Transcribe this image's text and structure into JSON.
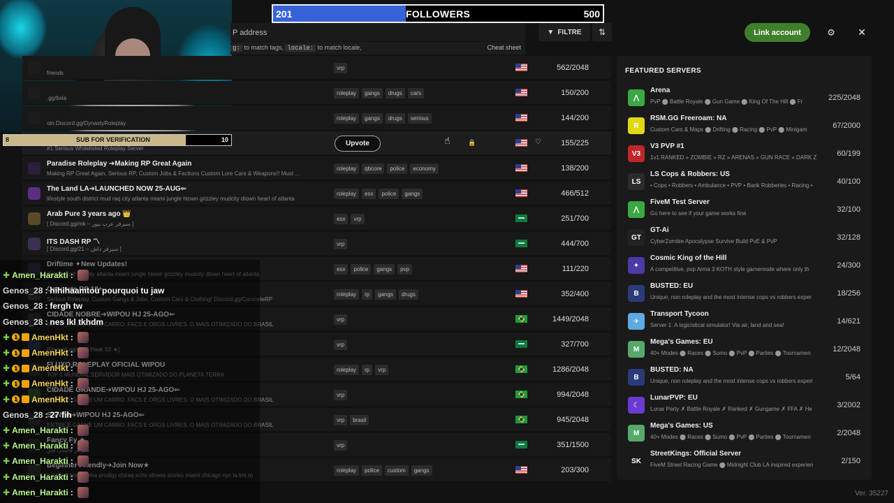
{
  "header": {
    "search_placeholder": "P address",
    "hint_code1": "g:",
    "hint_text1": " to match tags, ",
    "hint_code2": "locale:",
    "hint_text2": " to match locale,",
    "cheat_sheet": "Cheat sheet",
    "filter_label": "FILTRE",
    "link_account": "Link account"
  },
  "followers_goal": {
    "current": "201",
    "label": "FOLLOWERS",
    "goal": "500",
    "fraction": 0.402
  },
  "sub_goal": {
    "current": "8",
    "label": "SUB FOR VERIFICATION",
    "goal": "10",
    "fraction": 0.8
  },
  "servers": [
    {
      "name": "",
      "desc": "friends",
      "tags": [
        "vrp"
      ],
      "flag": "us",
      "players": "562/2048",
      "icon_color": "#1c1c1c"
    },
    {
      "name": "",
      "desc": ".gg/bsla",
      "tags": [
        "roleplay",
        "gangs",
        "drugs",
        "cars"
      ],
      "flag": "us",
      "players": "150/200",
      "icon_color": "#1c1c1c"
    },
    {
      "name": "",
      "desc": "oin Discord.gg/DynastyRoleplay",
      "tags": [
        "roleplay",
        "gangs",
        "drugs",
        "serious"
      ],
      "flag": "us",
      "players": "144/200",
      "icon_color": "#1c1c1c"
    },
    {
      "name": "",
      "desc": "#1 Serious Whitelisted Roleplay Server",
      "tags": [],
      "flag": "us",
      "players": "155/225",
      "icon_color": "#1c1c1c",
      "upvote": "Upvote",
      "highlight": true
    },
    {
      "name": "Paradise Roleplay ➔Making RP Great Again",
      "desc": "Making RP Great Again, Serious RP, Custom Jobs & Factions Custom Lore Cars & Weapons!! Must ...",
      "tags": [
        "roleplay",
        "qbcore",
        "police",
        "economy"
      ],
      "flag": "us",
      "players": "138/200",
      "icon_color": "#2a1f3c"
    },
    {
      "name": "The Land LA➔LAUNCHED NOW 25-AUG⇐",
      "desc": "lifestyle south district mud raq city atlanta miami jungle htown grizzley mudcity dtown heart of atlanta",
      "tags": [
        "roleplay",
        "esx",
        "police",
        "gangs"
      ],
      "flag": "us",
      "players": "466/512",
      "icon_color": "#5a2f83"
    },
    {
      "name": "Arab Pure 3 years ago 👑",
      "desc": "[ Discord.gg/mk – سيرفر عرب بيور ]",
      "tags": [
        "esx",
        "vrp"
      ],
      "flag": "sa",
      "players": "251/700",
      "icon_color": "#5a4a2a"
    },
    {
      "name": "ITS DASH RP 〽",
      "desc": "[ Discord.gg/21 – سيرفر داش ]",
      "tags": [
        "vrp"
      ],
      "flag": "sa",
      "players": "444/700",
      "icon_color": "#3c3052"
    },
    {
      "name": "Driftime ✦New Updates!",
      "desc": "district mud raq city atlanta miami jungle htown grizzley mudcity dtown heart of atlanta",
      "tags": [
        "esx",
        "police",
        "gangs",
        "pvp"
      ],
      "flag": "us",
      "players": "111/220",
      "icon_color": "#2a2a3c"
    },
    {
      "name": "Concrete RP 18+",
      "desc": "Serious Roleplay, Custom Gangs & Jobs, Custom Cars & Clothing! Discord.gg/ConcreteRP",
      "tags": [
        "roleplay",
        "rp",
        "gangs",
        "drugs"
      ],
      "flag": "us",
      "players": "352/400",
      "icon_color": "#333"
    },
    {
      "name": "CIDADE NOBRE➔WIPOU HJ 25-AGO⇐",
      "desc": "ENTRE E GANHE UM CARRO. FACS E ORGS LIVRES. O MAIS OTIMIZADO DO BRASIL",
      "tags": [
        "vrp"
      ],
      "flag": "br",
      "players": "1449/2048",
      "icon_color": "#2d2d2d"
    },
    {
      "name": "",
      "desc": "[Discord.gg/s2 ➔ Peak S2 ★]",
      "tags": [
        "vrp"
      ],
      "flag": "sa",
      "players": "327/700",
      "icon_color": "#24314a"
    },
    {
      "name": "FLUXO ROLEPLAY OFICIAL WIPOU",
      "desc": "TOP 1 MUNDIAL SERVIDOR MAIS OTIMIZADO DO PLANETA TERRA",
      "tags": [
        "roleplay",
        "rp",
        "vrp"
      ],
      "flag": "br",
      "players": "1286/2048",
      "icon_color": "#2d2d2d"
    },
    {
      "name": "CIDADE GRANDE➔WIPOU HJ 25-AGO⇐",
      "desc": "ENTRE E GANHE UM CARRO. FACS E ORGS LIVRES. O MAIS OTIMIZADO DO BRASIL",
      "tags": [
        "vrp"
      ],
      "flag": "br",
      "players": "994/2048",
      "icon_color": "#2a4a2a"
    },
    {
      "name": "SANTA➔WIPOU HJ 25-AGO⇐",
      "desc": "ENTRE E GANHE UM CARRO. FACS E ORGS LIVRES. O MAIS OTIMIZADO DO BRASIL",
      "tags": [
        "vrp",
        "brasil"
      ],
      "flag": "br",
      "players": "945/2048",
      "icon_color": "#2d2d2d"
    },
    {
      "name": "Fancy Fy ★",
      "desc": "سيرفر فانسي فاي",
      "tags": [
        "vrp"
      ],
      "flag": "sa",
      "players": "351/1500",
      "icon_color": "#2d2d2d"
    },
    {
      "name": "Beginner Friendly➔Join Now★",
      "desc": "h d town hoods pma prodigy chiraq echo streets stories miami chicago nyc la lmt rp",
      "tags": [
        "roleplay",
        "police",
        "custom",
        "gangs"
      ],
      "flag": "us",
      "players": "203/300",
      "icon_color": "#2d2d2d"
    }
  ],
  "featured": {
    "title": "FEATURED SERVERS",
    "items": [
      {
        "name": "Arena",
        "desc": "PvP ⬤ Battle Royale ⬤ Gun Game ⬤ King Of The Hill ⬤ Fr",
        "players": "225/2048",
        "icon_color": "#3aa843",
        "icon_glyph": "⋀"
      },
      {
        "name": "RSM.GG Freeroam: NA",
        "desc": "Custom Cars & Maps ⬤ Drifting ⬤ Racing ⬤ PvP ⬤ Minigam",
        "players": "67/2000",
        "icon_color": "#e1d814",
        "icon_glyph": "R"
      },
      {
        "name": "V3 PVP #1",
        "desc": "1v1 RANKED » ZOMBIE » RZ » ARENAS » GUN RACE » DARK Z",
        "players": "60/199",
        "icon_color": "#c0262a",
        "icon_glyph": "V3"
      },
      {
        "name": "LS Cops & Robbers: US",
        "desc": "• Cops • Robbers • Ambulance • PVP • Bank Robberies • Racing •",
        "players": "40/100",
        "icon_color": "#2b2b2b",
        "icon_glyph": "LS"
      },
      {
        "name": "FiveM Test Server",
        "desc": "Go here to see if your game works fine",
        "players": "32/100",
        "icon_color": "#3aa843",
        "icon_glyph": "⋀"
      },
      {
        "name": "GT-Ai",
        "desc": "CyberZombie Apocalypse Survive Build PvE & PvP",
        "players": "32/128",
        "icon_color": "#222",
        "icon_glyph": "GT"
      },
      {
        "name": "Cosmic King of the Hill",
        "desc": "A competitive, pvp Arma 3 KOTH style gamemode where only th",
        "players": "24/300",
        "icon_color": "#4b3aa8",
        "icon_glyph": "✦"
      },
      {
        "name": "BUSTED: EU",
        "desc": "Unique, non roleplay and the most intense cops vs robbers exper",
        "players": "18/256",
        "icon_color": "#2b3b7a",
        "icon_glyph": "B"
      },
      {
        "name": "Transport Tycoon",
        "desc": "Server 1: A logicistical simulator! Via air, land and sea!",
        "players": "14/621",
        "icon_color": "#5da9e0",
        "icon_glyph": "✈"
      },
      {
        "name": "Mega's Games: EU",
        "desc": "40+ Modes ⬤ Races ⬤ Sumo ⬤ PvP ⬤ Parties ⬤ Tournamen",
        "players": "12/2048",
        "icon_color": "#57a86b",
        "icon_glyph": "M"
      },
      {
        "name": "BUSTED: NA",
        "desc": "Unique, non roleplay and the most intense cops vs robbers experi",
        "players": "5/64",
        "icon_color": "#2b3b7a",
        "icon_glyph": "B"
      },
      {
        "name": "LunarPVP: EU",
        "desc": "Lunar Party ✗ Battle Royale ✗ Ranked ✗ Gungame ✗ FFA ✗ He",
        "players": "3/2002",
        "icon_color": "#6b3ad1",
        "icon_glyph": "☾"
      },
      {
        "name": "Mega's Games: US",
        "desc": "40+ Modes ⬤ Races ⬤ Sumo ⬤ PvP ⬤ Parties ⬤ Tournamen",
        "players": "2/2048",
        "icon_color": "#57a86b",
        "icon_glyph": "M"
      },
      {
        "name": "StreetKings: Official Server",
        "desc": "FiveM Street Racing Game ⬤ Midnight Club LA inspired experien",
        "players": "2/150",
        "icon_color": "#1a1a1a",
        "icon_glyph": "SK"
      }
    ]
  },
  "chat": [
    {
      "user": "Amen_Harakti",
      "msg": "",
      "style": "green",
      "badges": "plus",
      "emote": true
    },
    {
      "user": "Genos_28",
      "msg": "hihihaamtou pourquoi tu jaw",
      "style": "grey",
      "badges": "",
      "emote": false
    },
    {
      "user": "Genos_28",
      "msg": "fergh tw",
      "style": "grey",
      "badges": "",
      "emote": false
    },
    {
      "user": "Genos_28",
      "msg": "nes lkl tkhdm",
      "style": "grey",
      "badges": "",
      "emote": false
    },
    {
      "user": "AmenHkt",
      "msg": "",
      "style": "gold",
      "badges": "full",
      "emote": true
    },
    {
      "user": "AmenHkt",
      "msg": "",
      "style": "gold",
      "badges": "full",
      "emote": true
    },
    {
      "user": "AmenHkt",
      "msg": "",
      "style": "gold",
      "badges": "full",
      "emote": true
    },
    {
      "user": "AmenHkt",
      "msg": "",
      "style": "gold",
      "badges": "full",
      "emote": true
    },
    {
      "user": "AmenHkt",
      "msg": "",
      "style": "gold",
      "badges": "full",
      "emote": true
    },
    {
      "user": "Genos_28",
      "msg": "27 fih",
      "style": "grey",
      "badges": "",
      "emote": false
    },
    {
      "user": "Amen_Harakti",
      "msg": "",
      "style": "green",
      "badges": "plus",
      "emote": true
    },
    {
      "user": "Amen_Harakti",
      "msg": "",
      "style": "green",
      "badges": "plus",
      "emote": true
    },
    {
      "user": "Amen_Harakti",
      "msg": "",
      "style": "green",
      "badges": "plus",
      "emote": true
    },
    {
      "user": "Amen_Harakti",
      "msg": "",
      "style": "green",
      "badges": "plus",
      "emote": true
    },
    {
      "user": "Amen_Harakti",
      "msg": "",
      "style": "green",
      "badges": "plus",
      "emote": true
    }
  ],
  "version": "Ver. 35227"
}
